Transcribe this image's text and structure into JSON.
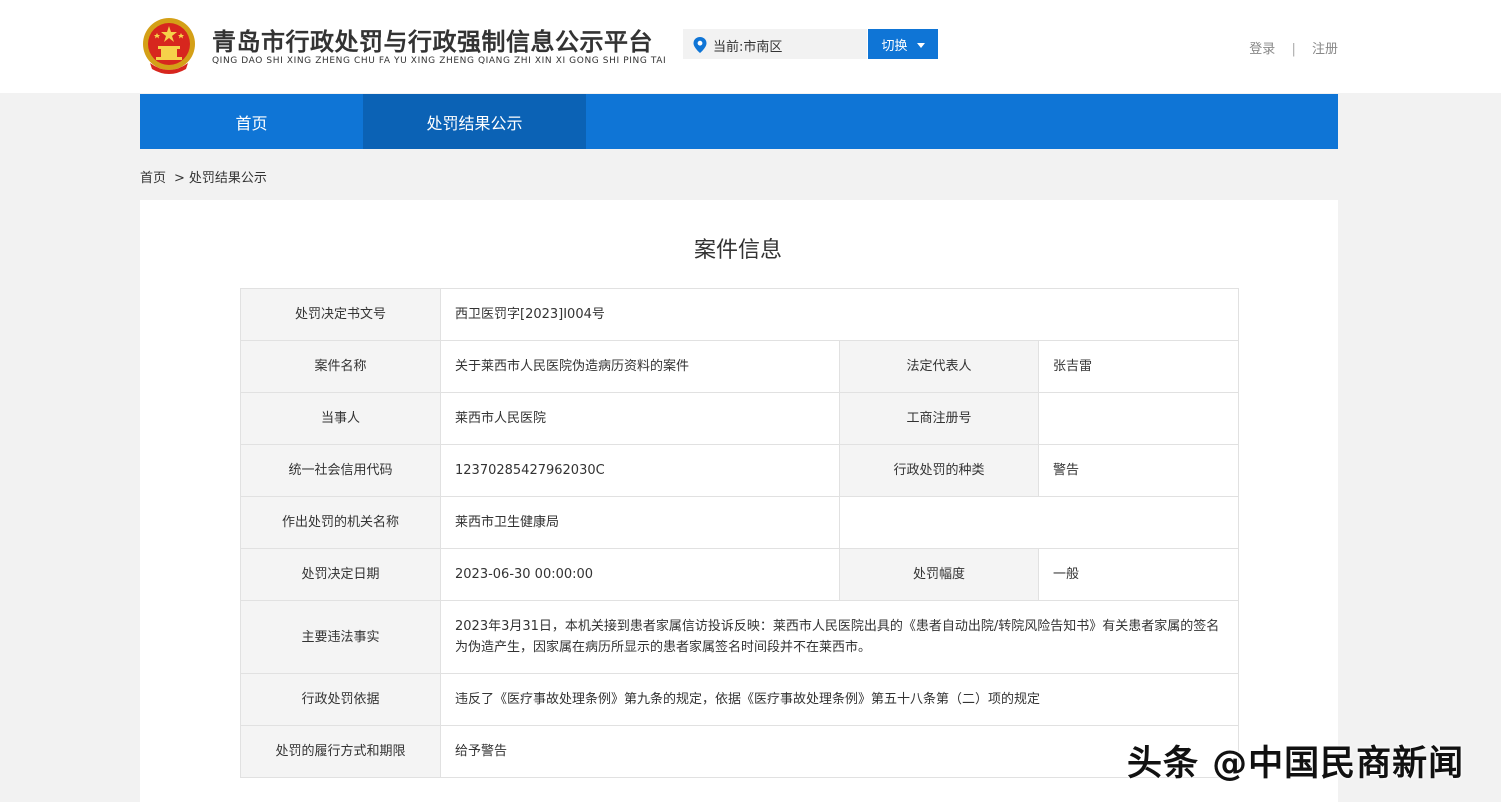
{
  "header": {
    "site_title": "青岛市行政处罚与行政强制信息公示平台",
    "site_subtitle": "QING DAO SHI XING ZHENG CHU FA YU XING ZHENG QIANG ZHI XIN XI GONG SHI PING TAI",
    "location_text": "当前:市南区",
    "switch_label": "切换",
    "login_label": "登录",
    "separator": "|",
    "register_label": "注册"
  },
  "nav": {
    "items": [
      {
        "label": "首页",
        "active": false
      },
      {
        "label": "处罚结果公示",
        "active": true
      }
    ]
  },
  "breadcrumb": {
    "home": "首页",
    "arrow": ">",
    "current": "处罚结果公示"
  },
  "panel": {
    "title": "案件信息"
  },
  "case": {
    "decision_no_label": "处罚决定书文号",
    "decision_no": "西卫医罚字[2023]Ⅰ004号",
    "case_name_label": "案件名称",
    "case_name": "关于莱西市人民医院伪造病历资料的案件",
    "legal_rep_label": "法定代表人",
    "legal_rep": "张吉雷",
    "party_label": "当事人",
    "party": "莱西市人民医院",
    "biz_reg_label": "工商注册号",
    "biz_reg": "",
    "credit_code_label": "统一社会信用代码",
    "credit_code": "12370285427962030C",
    "penalty_type_label": "行政处罚的种类",
    "penalty_type": "警告",
    "authority_label": "作出处罚的机关名称",
    "authority": "莱西市卫生健康局",
    "decision_date_label": "处罚决定日期",
    "decision_date": "2023-06-30 00:00:00",
    "degree_label": "处罚幅度",
    "degree": "一般",
    "facts_label": "主要违法事实",
    "facts": "2023年3月31日，本机关接到患者家属信访投诉反映：莱西市人民医院出具的《患者自动出院/转院风险告知书》有关患者家属的签名为伪造产生，因家属在病历所显示的患者家属签名时间段并不在莱西市。",
    "basis_label": "行政处罚依据",
    "basis": "违反了《医疗事故处理条例》第九条的规定，依据《医疗事故处理条例》第五十八条第（二）项的规定",
    "execution_label": "处罚的履行方式和期限",
    "execution": "给予警告"
  },
  "watermark": {
    "text": "头条 @中国民商新闻"
  },
  "colors": {
    "brand_blue": "#0f75d6",
    "nav_active": "#0b62b5",
    "label_bg": "#f4f4f4",
    "page_bg": "#f2f2f2"
  }
}
